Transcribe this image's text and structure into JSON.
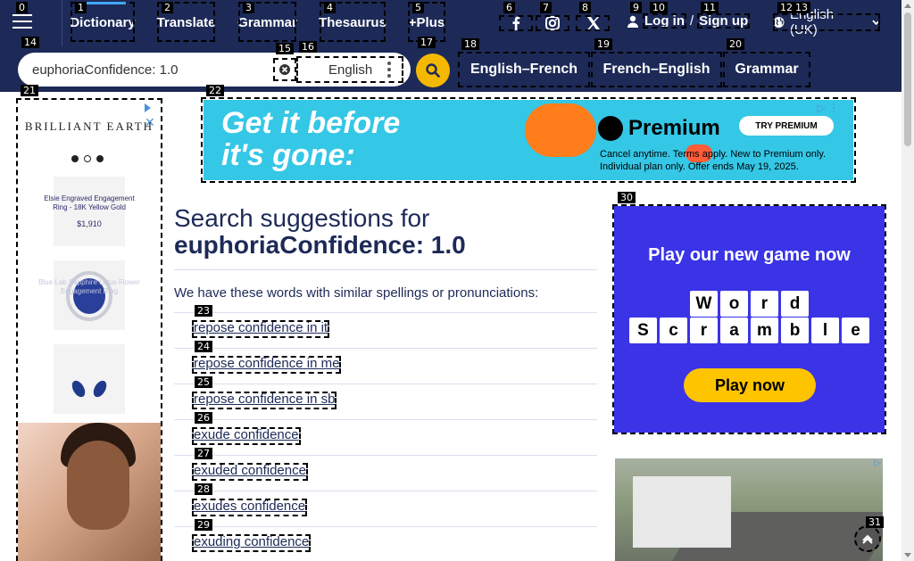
{
  "nav": {
    "links": [
      {
        "label": "Dictionary",
        "marker": "1"
      },
      {
        "label": "Translate",
        "marker": "2"
      },
      {
        "label": "Grammar",
        "marker": "3"
      },
      {
        "label": "Thesaurus",
        "marker": "4"
      },
      {
        "label": "+Plus",
        "marker": "5"
      }
    ],
    "menu_marker": "0",
    "social": [
      {
        "icon": "facebook-icon",
        "marker": "6"
      },
      {
        "icon": "instagram-icon",
        "marker": "7"
      },
      {
        "icon": "x-icon",
        "marker": "8"
      }
    ],
    "login": {
      "login_label": "Log in",
      "separator": "/",
      "signup_label": "Sign up",
      "marker_user": "9",
      "marker_login": "10",
      "marker_signup": "11"
    },
    "language": {
      "label": "English (UK)",
      "marker_a": "12",
      "marker_b": "13"
    }
  },
  "search": {
    "value": "euphoriaConfidence: 1.0",
    "marker": "14",
    "clear_marker": "15",
    "language_label": "English",
    "language_marker": "16",
    "submit_marker": "17"
  },
  "dict_tabs": [
    {
      "label": "English–French",
      "marker": "18"
    },
    {
      "label": "French–English",
      "marker": "19"
    },
    {
      "label": "Grammar",
      "marker": "20"
    }
  ],
  "ads": {
    "left_marker": "21",
    "left_brand": "BRILLIANT EARTH",
    "left_items": [
      {
        "caption": "Elsie Engraved Engagement Ring - 18K Yellow Gold",
        "price": "$1,910"
      },
      {
        "caption": "Blue Lab Sapphire Lotus Flower Engagement Ring",
        "price": ""
      },
      {
        "caption": "",
        "price": ""
      }
    ],
    "banner_marker": "22",
    "banner_headline_1": "Get it before",
    "banner_headline_2": "it's gone:",
    "banner_brand": "Premium",
    "banner_cta": "TRY PREMIUM",
    "banner_fine": "Cancel anytime. Terms apply. New to Premium only. Individual plan only. Offer ends May 19, 2025.",
    "game_marker": "30",
    "game_title": "Play our new game now",
    "game_row1": [
      "W",
      "o",
      "r",
      "d"
    ],
    "game_row2": [
      "S",
      "c",
      "r",
      "a",
      "m",
      "b",
      "l",
      "e"
    ],
    "game_cta": "Play now",
    "scroll_marker": "31"
  },
  "results": {
    "heading": "Search suggestions for",
    "query": "euphoriaConfidence: 1.0",
    "intro": "We have these words with similar spellings or pronunciations:",
    "suggestions": [
      {
        "text": "repose confidence in it",
        "marker": "23"
      },
      {
        "text": "repose confidence in me",
        "marker": "24"
      },
      {
        "text": "repose confidence in sb",
        "marker": "25"
      },
      {
        "text": "exude confidence",
        "marker": "26"
      },
      {
        "text": "exuded confidence",
        "marker": "27"
      },
      {
        "text": "exudes confidence",
        "marker": "28"
      },
      {
        "text": "exuding confidence",
        "marker": "29"
      }
    ]
  },
  "colors": {
    "navy": "#1d2a57",
    "accent_blue": "#3fa9f5",
    "search_yellow": "#f5b800"
  }
}
